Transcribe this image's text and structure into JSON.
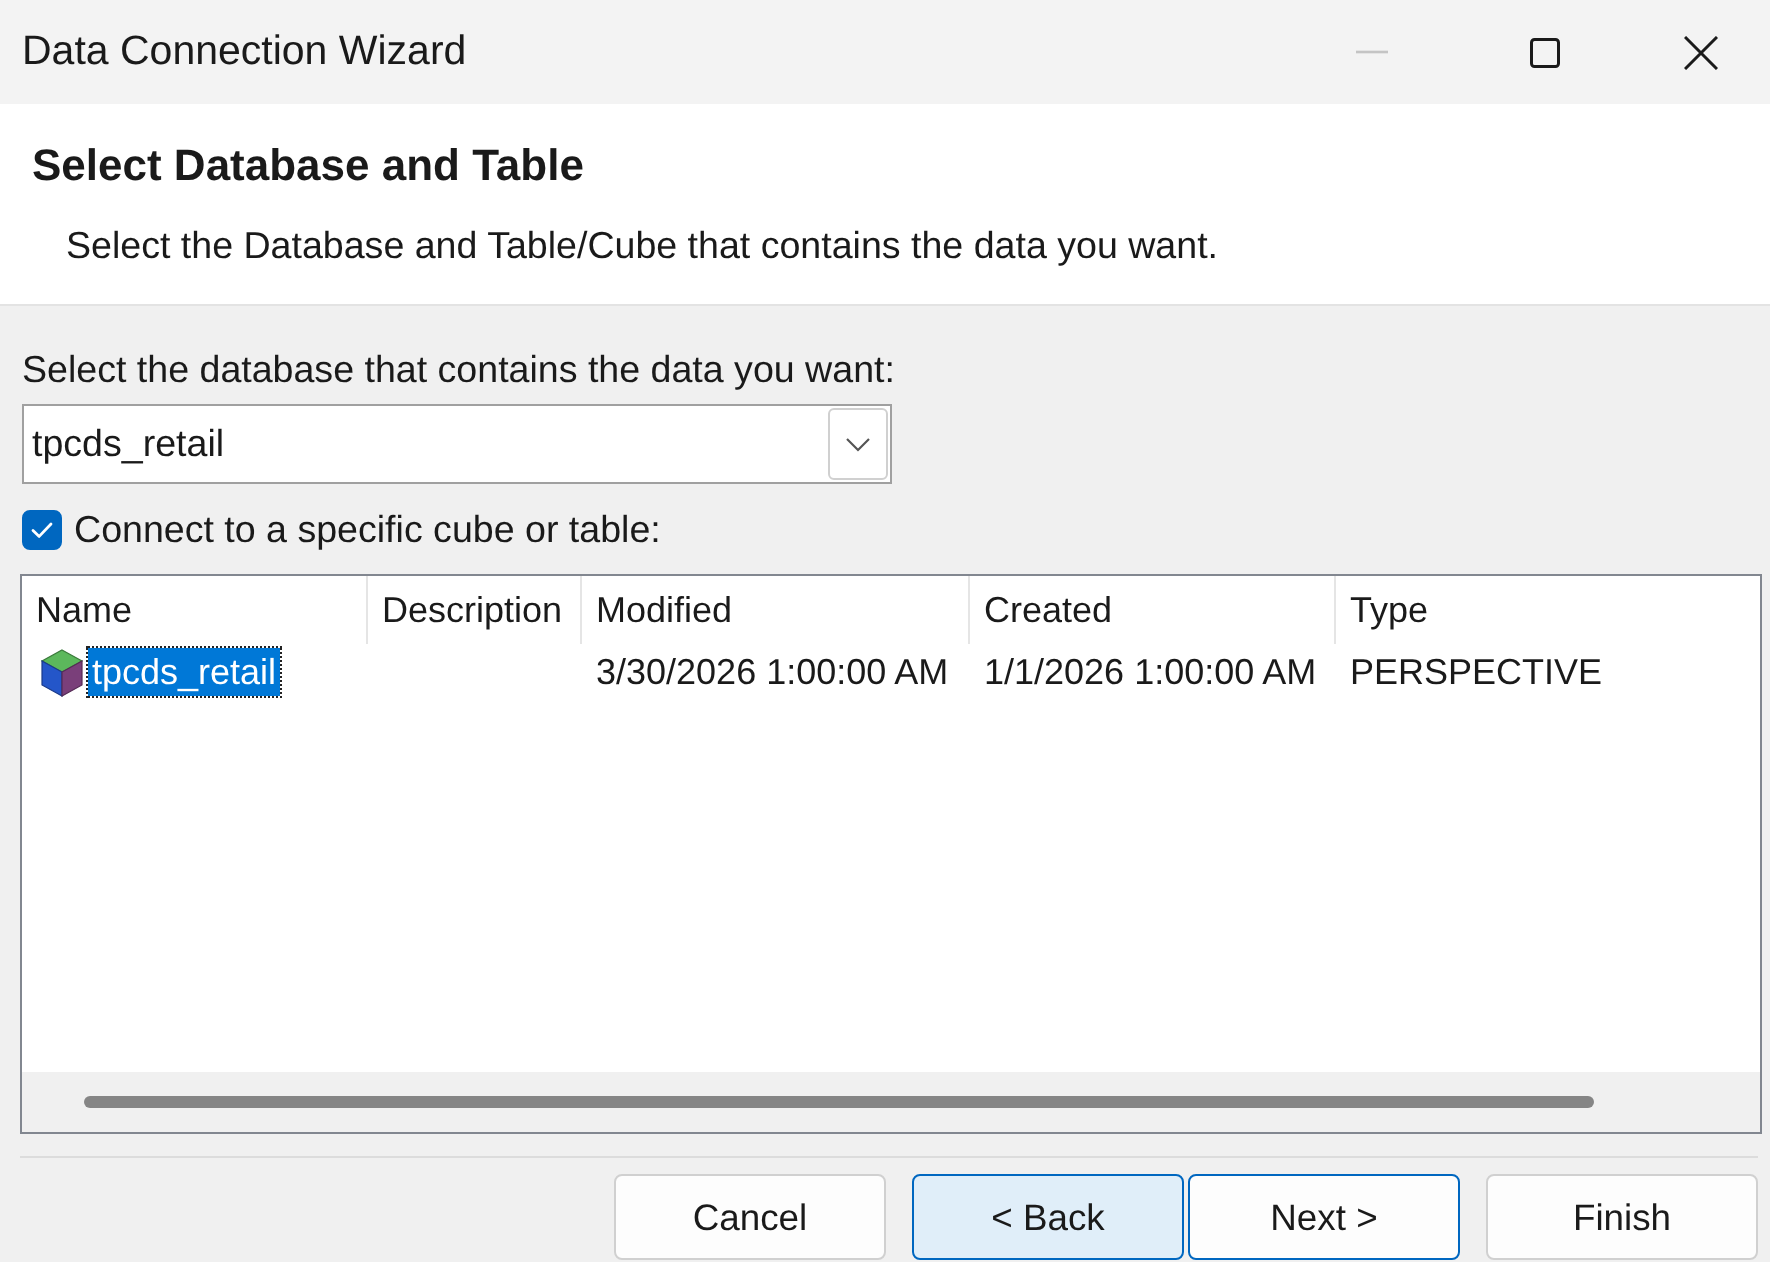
{
  "window": {
    "title": "Data Connection Wizard",
    "controls": [
      {
        "kind": "minimize",
        "disabled": true
      },
      {
        "kind": "maximize",
        "disabled": false
      },
      {
        "kind": "close",
        "disabled": false
      }
    ]
  },
  "header": {
    "title": "Select Database and Table",
    "subtitle": "Select the Database and Table/Cube that contains the data you want."
  },
  "database": {
    "label": "Select the database that contains the data you want:",
    "value": "tpcds_retail"
  },
  "specific_table": {
    "label": "Connect to a specific cube or table:",
    "checked": true
  },
  "table": {
    "columns": [
      "Name",
      "Description",
      "Modified",
      "Created",
      "Type"
    ],
    "rows": [
      {
        "name": "tpcds_retail",
        "modified": "3/30/2026 1:00:00 AM",
        "created": "1/1/2026 1:00:00 AM",
        "type": "PERSPECTIVE",
        "selected": true
      }
    ]
  },
  "buttons": [
    {
      "label": "Cancel",
      "hovered": false,
      "default": false
    },
    {
      "label": "< Back",
      "hovered": true,
      "default": false
    },
    {
      "label": "Next >",
      "hovered": false,
      "default": true
    },
    {
      "label": "Finish",
      "hovered": false,
      "default": false
    }
  ]
}
